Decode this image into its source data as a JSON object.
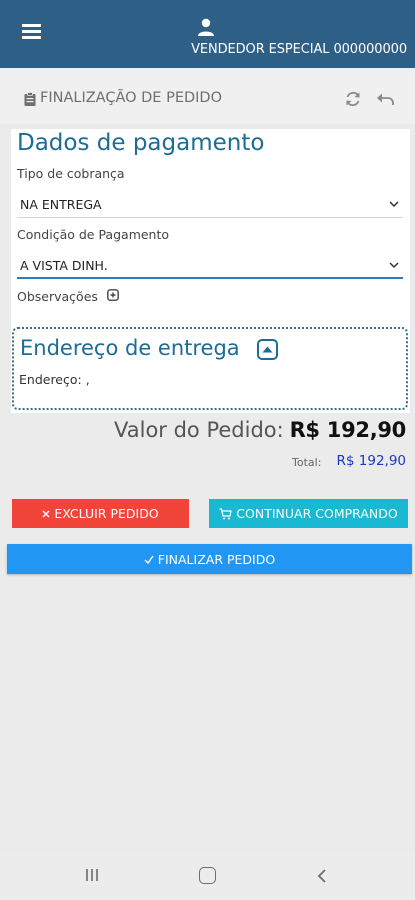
{
  "header": {
    "vendor_label": "VENDEDOR ESPECIAL 000000000"
  },
  "page": {
    "title": "FINALIZAÇÃO DE PEDIDO"
  },
  "payment": {
    "section_title": "Dados de pagamento",
    "tipo_label": "Tipo de cobrança",
    "tipo_value": "NA ENTREGA",
    "condicao_label": "Condição de Pagamento",
    "condicao_value": "A VISTA DINH.",
    "observacoes_label": "Observações"
  },
  "address": {
    "section_title": "Endereço de entrega",
    "endereco_text": "Endereço: ,"
  },
  "totals": {
    "valor_label": "Valor do Pedido:",
    "valor_amount": "R$ 192,90",
    "total_label": "Total:",
    "total_amount": "R$ 192,90"
  },
  "buttons": {
    "excluir": "EXCLUIR PEDIDO",
    "continuar": "CONTINUAR COMPRANDO",
    "finalizar": "FINALIZAR PEDIDO"
  },
  "colors": {
    "primary": "#2e5f86",
    "excluir": "#f2453a",
    "continuar": "#1ab8d2",
    "finalizar": "#2296f3"
  },
  "icons": [
    "menu-icon",
    "user-icon",
    "clipboard-icon",
    "refresh-icon",
    "undo-icon",
    "chevron-down-icon",
    "plus-box-icon",
    "collapse-icon",
    "close-icon",
    "cart-icon",
    "check-icon"
  ]
}
